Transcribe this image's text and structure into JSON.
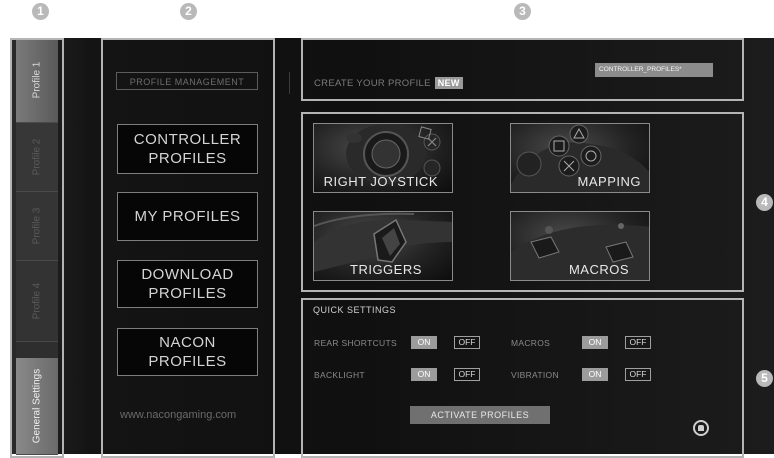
{
  "callouts": [
    "1",
    "2",
    "3",
    "4",
    "5"
  ],
  "tabs": [
    {
      "label": "Profile 1",
      "state": "active"
    },
    {
      "label": "Profile 2",
      "state": "inactive"
    },
    {
      "label": "Profile 3",
      "state": "inactive"
    },
    {
      "label": "Profile 4",
      "state": "inactive"
    },
    {
      "label": "General Settings",
      "state": "highlight"
    }
  ],
  "profile_management": {
    "heading": "PROFILE MANAGEMENT",
    "buttons": [
      {
        "line1": "CONTROLLER",
        "line2": "PROFILES"
      },
      {
        "line1": "MY PROFILES",
        "line2": ""
      },
      {
        "line1": "DOWNLOAD",
        "line2": "PROFILES"
      },
      {
        "line1": "NACON",
        "line2": "PROFILES"
      }
    ],
    "website": "www.nacongaming.com"
  },
  "create_profile": {
    "label": "CREATE YOUR PROFILE",
    "badge": "NEW",
    "selected_profile": "CONTROLLER_PROFILES*"
  },
  "tiles": [
    {
      "label": "RIGHT JOYSTICK",
      "icon": "joystick-icon"
    },
    {
      "label": "MAPPING",
      "icon": "face-buttons-icon"
    },
    {
      "label": "TRIGGERS",
      "icon": "trigger-icon"
    },
    {
      "label": "MACROS",
      "icon": "back-buttons-icon"
    }
  ],
  "quick_settings": {
    "title": "QUICK SETTINGS",
    "items": [
      {
        "label": "REAR SHORTCUTS",
        "on": "ON",
        "off": "OFF",
        "state": "ON"
      },
      {
        "label": "MACROS",
        "on": "ON",
        "off": "OFF",
        "state": "ON"
      },
      {
        "label": "BACKLIGHT",
        "on": "ON",
        "off": "OFF",
        "state": "ON"
      },
      {
        "label": "VIBRATION",
        "on": "ON",
        "off": "OFF",
        "state": "ON"
      }
    ],
    "activate_label": "ACTIVATE PROFILES"
  },
  "colors": {
    "accent": "#9c9c9c",
    "background": "#101010",
    "callout": "#b9b9b9"
  }
}
